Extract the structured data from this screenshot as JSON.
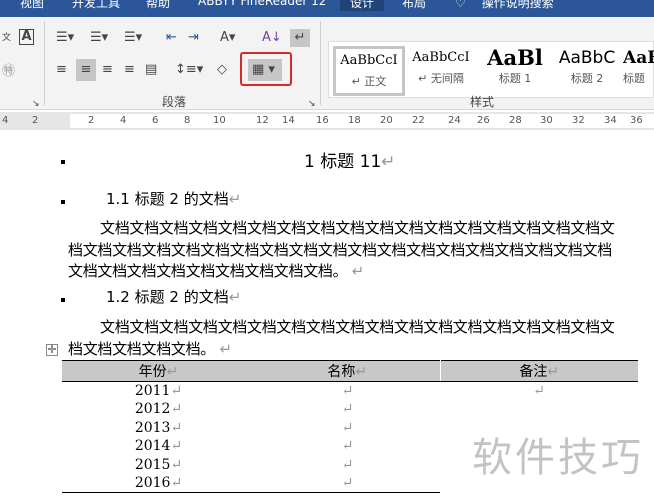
{
  "tabs": [
    "视图",
    "开发工具",
    "帮助",
    "ABBYY FineReader 12",
    "设计",
    "布局",
    "操作说明搜索"
  ],
  "ribbon": {
    "paragraph_group": "段落",
    "styles_group": "样式",
    "styles": [
      {
        "preview": "AaBbCcI",
        "name": "↵ 正文"
      },
      {
        "preview": "AaBbCcI",
        "name": "↵ 无间隔"
      },
      {
        "preview": "AaBl",
        "name": "标题 1"
      },
      {
        "preview": "AaBbC",
        "name": "标题 2"
      },
      {
        "preview": "AaB",
        "name": "标题"
      }
    ]
  },
  "ruler": [
    "4",
    "2",
    "2",
    "4",
    "6",
    "8",
    "10",
    "12",
    "14",
    "16",
    "18",
    "20",
    "22",
    "24",
    "26",
    "28",
    "30",
    "32",
    "34",
    "36"
  ],
  "doc": {
    "h1": "1 标题 11",
    "h2a": "1.1 标题 2 的文档",
    "p1": "文档文档文档文档文档文档文档文档文档文档文档文档文档文档文档文档文档文档文档文档文档文档文档文档文档文档文档文档文档文档文档文档文档文档文档文档文档文档文档文档文档文档文档文档文档。",
    "h2b": "1.2 标题 2 的文档",
    "p2": "文档文档文档文档文档文档文档文档文档文档文档文档文档文档文档文档文档文档文档文档文档文档。",
    "mark": "↵",
    "table": {
      "headers": [
        "年份",
        "名称",
        "备注"
      ],
      "years": [
        "2011",
        "2012",
        "2013",
        "2014",
        "2015",
        "2016"
      ]
    }
  },
  "watermark": "软件技巧"
}
